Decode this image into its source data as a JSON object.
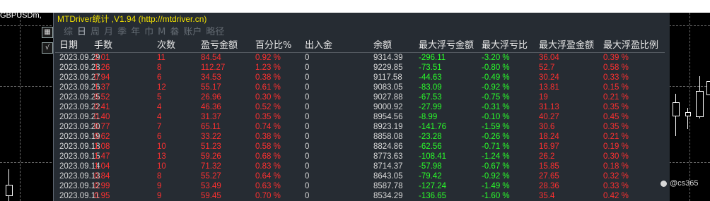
{
  "chart": {
    "symbol": "GBPUSDm,",
    "left_buttons": [
      "▦",
      "√"
    ]
  },
  "panel": {
    "title": "MTDriver统计 ,V1.94 (http://mtdriver.cn)",
    "tabs": [
      "综",
      "日",
      "周",
      "月",
      "季",
      "年",
      "巾",
      "M",
      "畚",
      "账户",
      "略径"
    ],
    "active_tab": "日",
    "headers": [
      "日期",
      "手数",
      "次数",
      "盈亏金额",
      "百分比%",
      "出入金",
      "余额",
      "最大浮亏金额",
      "最大浮亏比",
      "最大浮盈金额",
      "最大浮盈比例"
    ],
    "rows": [
      [
        "2023.09.29",
        "2.01",
        "11",
        "84.54",
        "0.92 %",
        "0",
        "9314.39",
        "-296.11",
        "-3.20 %",
        "36.04",
        "0.39 %"
      ],
      [
        "2023.09.28",
        "1.26",
        "8",
        "112.27",
        "1.23 %",
        "0",
        "9229.85",
        "-73.51",
        "-0.80 %",
        "52.7",
        "0.58 %"
      ],
      [
        "2023.09.27",
        "0.94",
        "6",
        "34.53",
        "0.38 %",
        "0",
        "9117.58",
        "-44.63",
        "-0.49 %",
        "30.24",
        "0.33 %"
      ],
      [
        "2023.09.26",
        "1.37",
        "12",
        "55.17",
        "0.61 %",
        "0",
        "9083.05",
        "-83.09",
        "-0.92 %",
        "13.81",
        "0.15 %"
      ],
      [
        "2023.09.25",
        "0.52",
        "5",
        "26.96",
        "0.30 %",
        "0",
        "9027.88",
        "-67.53",
        "-0.75 %",
        "19",
        "0.21 %"
      ],
      [
        "2023.09.22",
        "0.41",
        "4",
        "46.36",
        "0.52 %",
        "0",
        "9000.92",
        "-27.99",
        "-0.31 %",
        "31.13",
        "0.35 %"
      ],
      [
        "2023.09.21",
        "0.40",
        "4",
        "31.37",
        "0.35 %",
        "0",
        "8954.56",
        "-8.99",
        "-0.10 %",
        "40.27",
        "0.45 %"
      ],
      [
        "2023.09.20",
        "0.77",
        "7",
        "65.11",
        "0.74 %",
        "0",
        "8923.19",
        "-141.76",
        "-1.59 %",
        "30.6",
        "0.35 %"
      ],
      [
        "2023.09.19",
        "0.62",
        "6",
        "33.22",
        "0.38 %",
        "0",
        "8858.08",
        "-23.28",
        "-0.26 %",
        "18.24",
        "0.21 %"
      ],
      [
        "2023.09.18",
        "1.08",
        "10",
        "51.23",
        "0.58 %",
        "0",
        "8824.86",
        "-62.56",
        "-0.71 %",
        "16.97",
        "0.19 %"
      ],
      [
        "2023.09.15",
        "1.47",
        "13",
        "59.26",
        "0.68 %",
        "0",
        "8773.63",
        "-108.41",
        "-1.24 %",
        "26.2",
        "0.30 %"
      ],
      [
        "2023.09.14",
        "1.04",
        "10",
        "71.32",
        "0.83 %",
        "0",
        "8714.37",
        "-57.98",
        "-0.67 %",
        "15.85",
        "0.18 %"
      ],
      [
        "2023.09.13",
        "0.84",
        "8",
        "55.27",
        "0.64 %",
        "0",
        "8643.05",
        "-79.42",
        "-0.92 %",
        "27.65",
        "0.32 %"
      ],
      [
        "2023.09.12",
        "0.99",
        "9",
        "53.49",
        "0.63 %",
        "0",
        "8587.78",
        "-127.24",
        "-1.49 %",
        "28.36",
        "0.33 %"
      ],
      [
        "2023.09.11",
        "0.95",
        "9",
        "59.45",
        "0.70 %",
        "0",
        "8534.29",
        "-136.65",
        "-1.60 %",
        "35.4",
        "0.42 %"
      ]
    ]
  },
  "watermark": "@cs365"
}
